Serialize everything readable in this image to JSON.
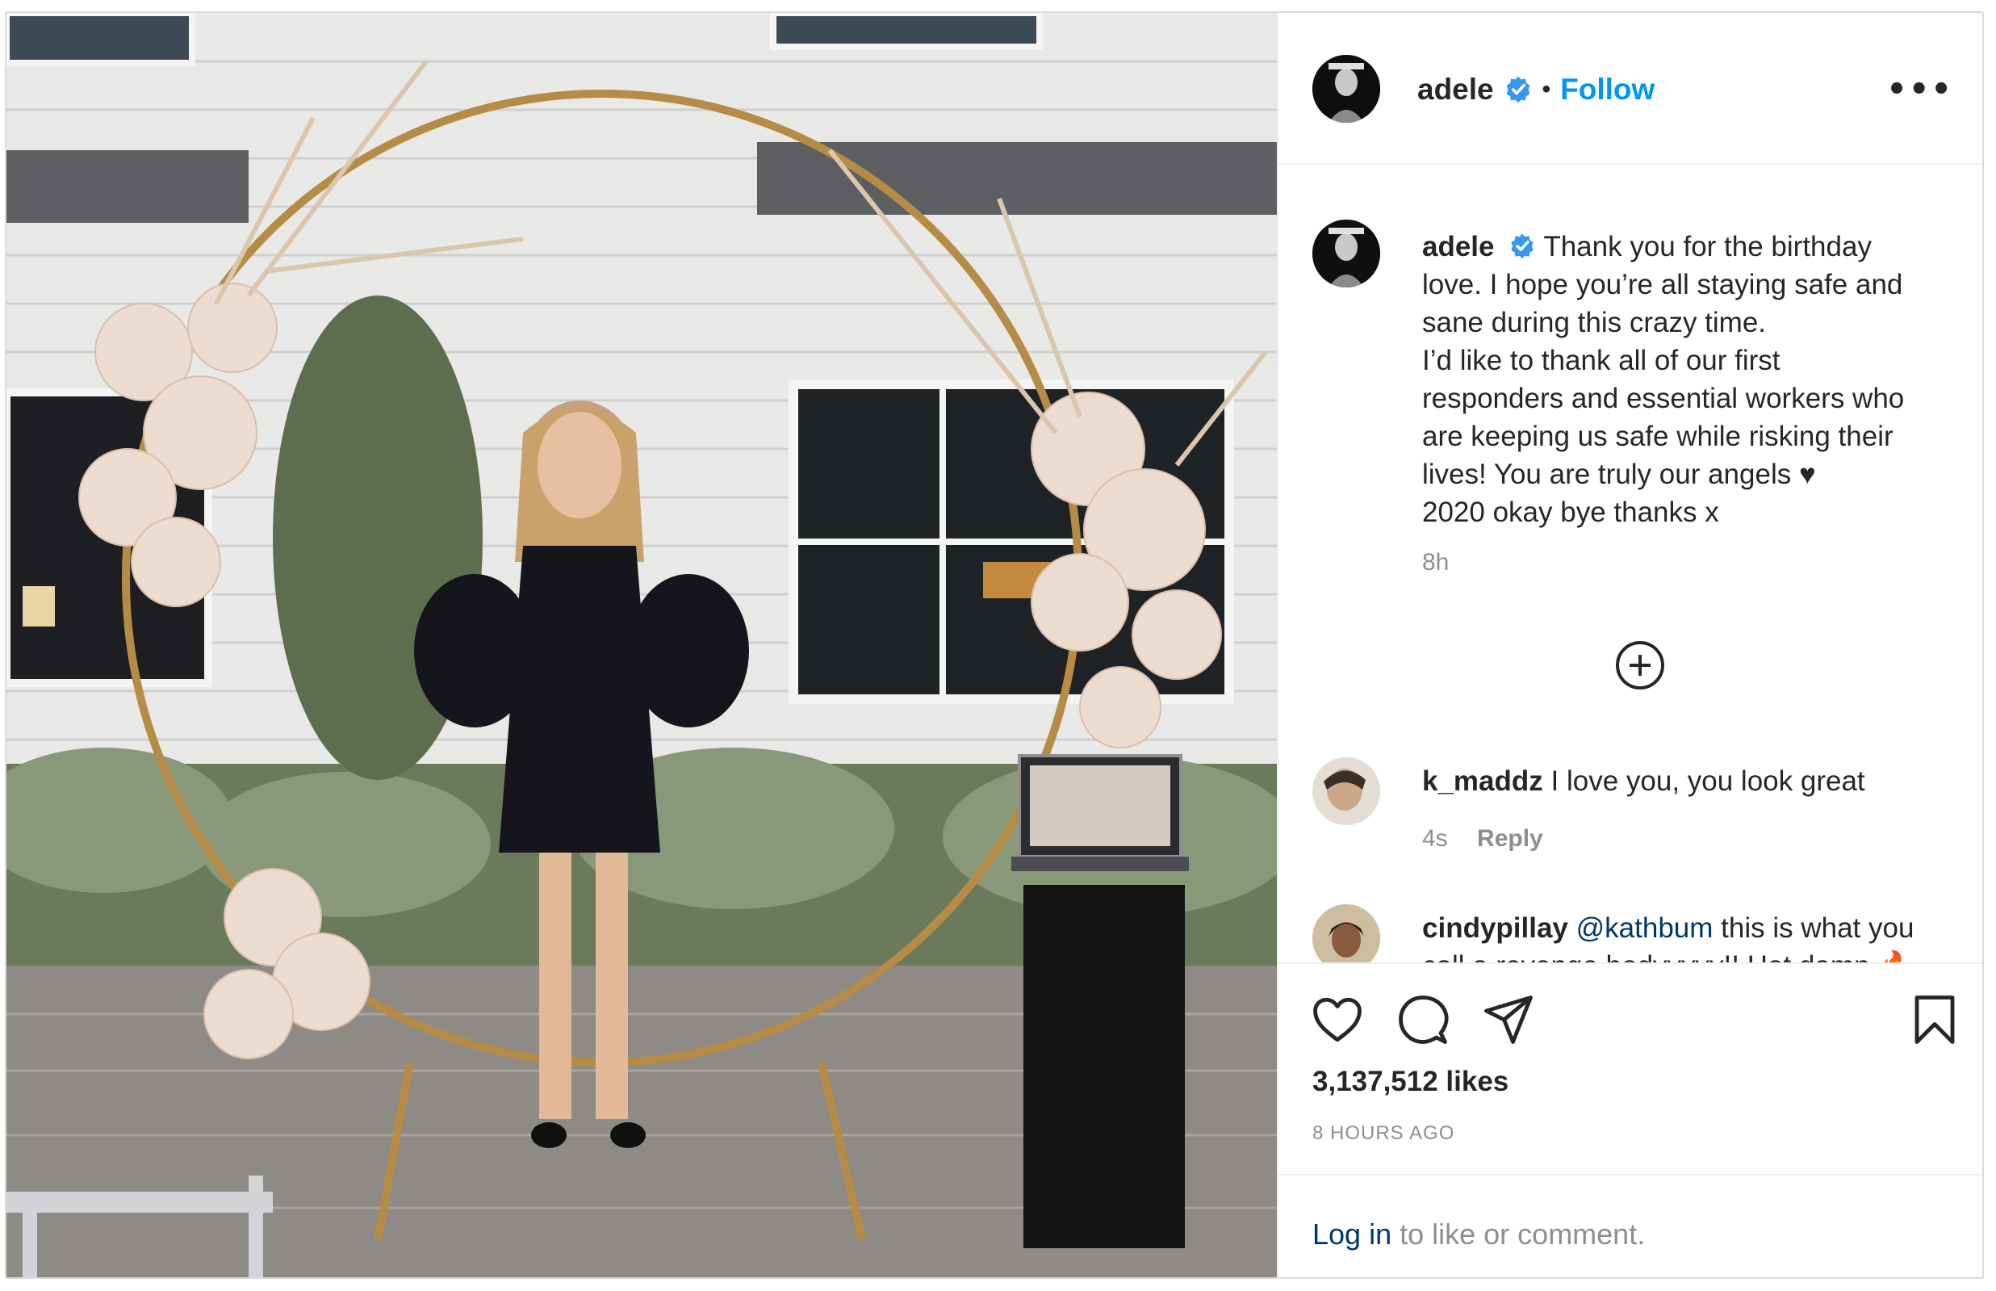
{
  "header": {
    "username": "adele",
    "separator": "•",
    "follow_label": "Follow",
    "more_label": "•••"
  },
  "caption": {
    "username": "adele",
    "lines": [
      "Thank you for the birthday",
      "love. I hope you’re all staying safe and",
      "sane during this crazy time.",
      "I’d like to thank all of our first",
      "responders and essential workers who",
      "are keeping us safe while risking their",
      "lives! You are truly our angels ♥",
      "2020 okay bye thanks x"
    ],
    "time": "8h"
  },
  "comments": [
    {
      "username": "k_maddz",
      "text": "I love you, you look great",
      "time": "4s",
      "reply_label": "Reply"
    },
    {
      "username": "cindypillay",
      "mention": "@kathbum",
      "text_line1": "this is what you",
      "text_line2": "call a revenge bodyyyyy!! Hot damn 🔥"
    }
  ],
  "actions": {
    "likes": "3,137,512 likes",
    "post_time": "8 HOURS AGO"
  },
  "login": {
    "link_label": "Log in",
    "rest_text": "to like or comment."
  },
  "colors": {
    "accent": "#0095f6",
    "link": "#00376b",
    "muted": "#8e8e8e",
    "text": "#262626",
    "border": "#dbdbdb"
  },
  "icons": [
    "verified-icon",
    "more-icon",
    "load-more-icon",
    "heart-icon",
    "comment-icon",
    "share-icon",
    "bookmark-icon"
  ]
}
